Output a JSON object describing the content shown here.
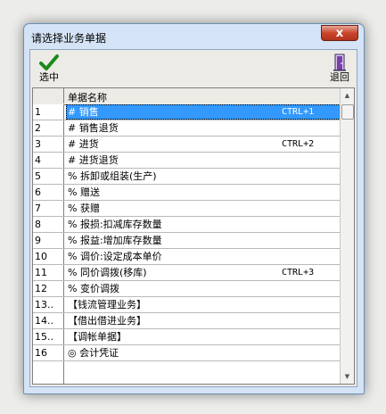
{
  "window": {
    "title": "请选择业务单据",
    "close_label": "x"
  },
  "toolbar": {
    "select_label": "选中",
    "back_label": "退回",
    "icons": {
      "select": "checkmark-icon",
      "back": "door-exit-icon"
    },
    "colors": {
      "checkmark": "#1a8a1a",
      "door": "#7a3ea8"
    }
  },
  "grid": {
    "column_header": "单据名称",
    "rows": [
      {
        "num": "1",
        "name": "# 销售",
        "shortcut": "CTRL+1",
        "selected": true
      },
      {
        "num": "2",
        "name": "# 销售退货",
        "shortcut": ""
      },
      {
        "num": "3",
        "name": "# 进货",
        "shortcut": "CTRL+2"
      },
      {
        "num": "4",
        "name": "# 进货退货",
        "shortcut": ""
      },
      {
        "num": "5",
        "name": "% 拆卸或组装(生产)",
        "shortcut": ""
      },
      {
        "num": "6",
        "name": "% 赠送",
        "shortcut": ""
      },
      {
        "num": "7",
        "name": "% 获赠",
        "shortcut": ""
      },
      {
        "num": "8",
        "name": "% 报损:扣减库存数量",
        "shortcut": ""
      },
      {
        "num": "9",
        "name": "% 报益:增加库存数量",
        "shortcut": ""
      },
      {
        "num": "10",
        "name": "% 调价:设定成本单价",
        "shortcut": ""
      },
      {
        "num": "11",
        "name": "% 同价调拨(移库)",
        "shortcut": "CTRL+3"
      },
      {
        "num": "12",
        "name": "% 变价调拨",
        "shortcut": ""
      },
      {
        "num": "13..",
        "name": "【钱流管理业务】",
        "shortcut": ""
      },
      {
        "num": "14..",
        "name": "【借出借进业务】",
        "shortcut": ""
      },
      {
        "num": "15..",
        "name": "【调帐单据】",
        "shortcut": ""
      },
      {
        "num": "16",
        "name": "◎ 会计凭证",
        "shortcut": ""
      }
    ],
    "selection_color": "#3399ff"
  }
}
